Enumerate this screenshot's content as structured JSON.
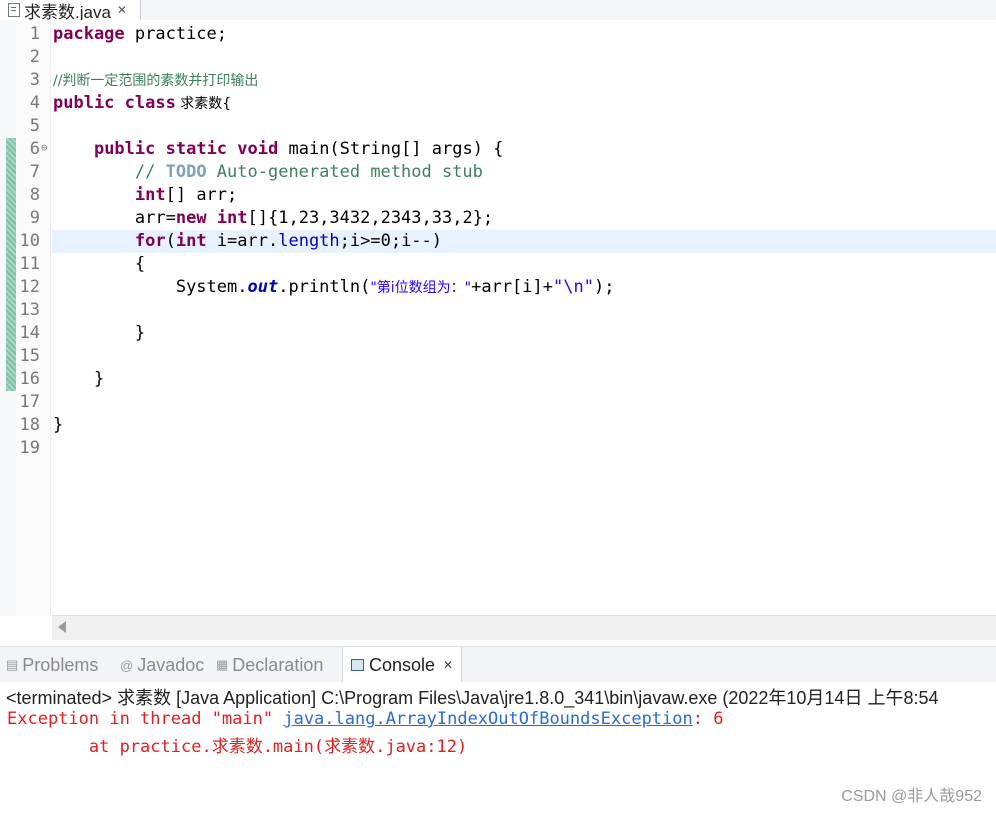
{
  "editor_tab": {
    "title": "求素数.java",
    "close": "✕"
  },
  "line_numbers": [
    "1",
    "2",
    "3",
    "4",
    "5",
    "6",
    "7",
    "8",
    "9",
    "10",
    "11",
    "12",
    "13",
    "14",
    "15",
    "16",
    "17",
    "18",
    "19"
  ],
  "fold_marker": "⊖",
  "code": {
    "l1_kw": "package",
    "l1_rest": " practice;",
    "l3_comment": "//判断一定范围的素数并打印输出",
    "l4_kw1": "public",
    "l4_kw2": "class",
    "l4_rest": " 求素数{",
    "l6_indent": "    ",
    "l6_kw1": "public",
    "l6_kw2": "static",
    "l6_kw3": "void",
    "l6_rest": " main(String[] args) {",
    "l7_indent": "        ",
    "l7_comment1": "// ",
    "l7_todo": "TODO",
    "l7_comment2": " Auto-generated method stub",
    "l8_indent": "        ",
    "l8_kw": "int",
    "l8_rest": "[] arr;",
    "l9_indent": "        ",
    "l9_a": "arr=",
    "l9_kw1": "new",
    "l9_kw2": "int",
    "l9_rest": "[]{1,23,3432,2343,33,2};",
    "l10_indent": "        ",
    "l10_kw1": "for",
    "l10_a": "(",
    "l10_kw2": "int",
    "l10_b": " i=arr.",
    "l10_field": "length",
    "l10_c": ";i>=0;i--)",
    "l11": "        {",
    "l12_indent": "            ",
    "l12_a": "System.",
    "l12_out": "out",
    "l12_b": ".println(",
    "l12_str1": "\"第i位数组为：\"",
    "l12_c": "+arr[i]+",
    "l12_str2": "\"\\n\"",
    "l12_d": ");",
    "l14": "        }",
    "l16": "    }",
    "l18": "}"
  },
  "views": {
    "problems": "Problems",
    "javadoc": "Javadoc",
    "declaration": "Declaration",
    "console": "Console",
    "close": "✕"
  },
  "console": {
    "status": "<terminated> 求素数 [Java Application] C:\\Program Files\\Java\\jre1.8.0_341\\bin\\javaw.exe  (2022年10月14日 上午8:54",
    "exc_prefix": "Exception in thread \"main\" ",
    "exc_link": "java.lang.ArrayIndexOutOfBoundsException",
    "exc_suffix": ": 6",
    "trace": "        at practice.求素数.main(求素数.java:12)"
  },
  "watermark": "CSDN @非人哉952"
}
